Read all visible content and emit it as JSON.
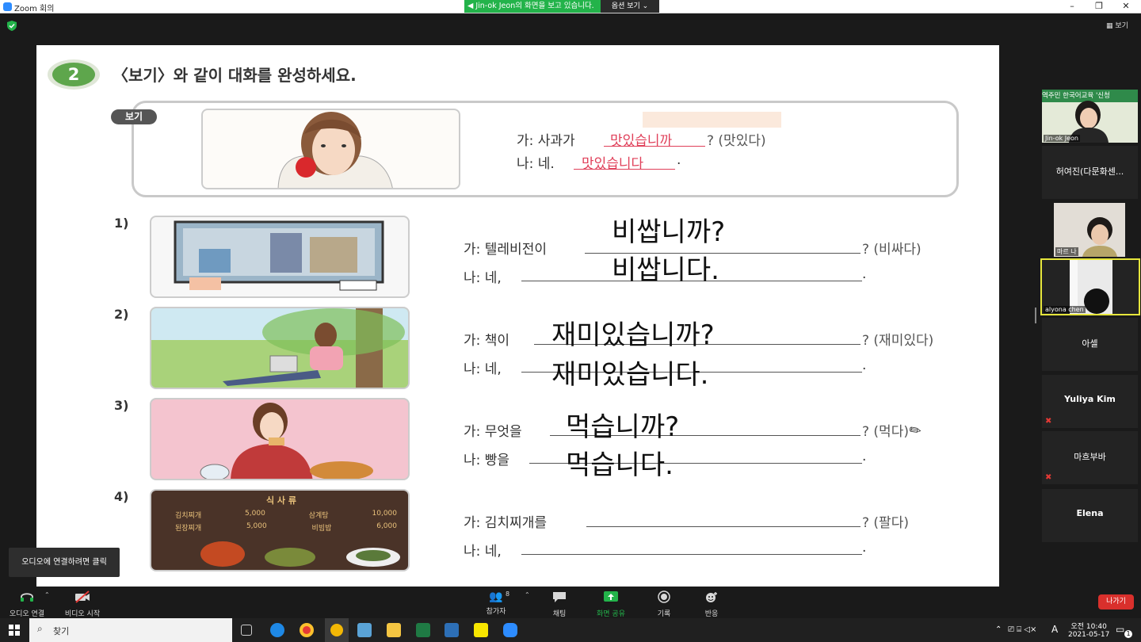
{
  "window": {
    "title": "Zoom 회의",
    "minimize": "–",
    "restore": "❐",
    "close": "✕"
  },
  "banner": {
    "sharing_text": "Jin-ok Jeon의 화면을 보고 있습니다.",
    "view_options": "옵션 보기 ⌄"
  },
  "top_right": {
    "view_label": "보기"
  },
  "slide": {
    "number": "2",
    "instruction": "〈보기〉와 같이 대화를 완성하세요.",
    "example_tag": "보기",
    "example": {
      "q_prefix": "가: 사과가",
      "q_answer": "맛있습니까",
      "q_hint": "? (맛있다)",
      "a_prefix": "나: 네.",
      "a_answer": "맛있습니다",
      "a_suffix": "."
    },
    "items": [
      {
        "num": "1)",
        "q_prefix": "가: 텔레비전이",
        "q_hint": "? (비싸다)",
        "a_prefix": "나: 네,",
        "a_suffix": ".",
        "q_written": "비쌉니까?",
        "a_written": "비쌉니다."
      },
      {
        "num": "2)",
        "q_prefix": "가: 책이",
        "q_hint": "? (재미있다)",
        "a_prefix": "나: 네,",
        "a_suffix": ".",
        "q_written": "재미있습니까?",
        "a_written": "재미있습니다."
      },
      {
        "num": "3)",
        "q_prefix": "가: 무엇을",
        "q_hint": "? (먹다)",
        "a_prefix": "나: 빵을",
        "a_suffix": ".",
        "q_written": "먹습니까?",
        "a_written": "먹습니다."
      },
      {
        "num": "4)",
        "q_prefix": "가: 김치찌개를",
        "q_hint": "? (팔다)",
        "a_prefix": "나: 네,",
        "a_suffix": ".",
        "q_written": "",
        "a_written": ""
      }
    ],
    "menu_board": {
      "title": "식 사 류",
      "rows": [
        [
          "김치찌개",
          "5,000",
          "삼계탕",
          "10,000"
        ],
        [
          "된장찌개",
          "5,000",
          "비빔밥",
          "6,000"
        ]
      ]
    }
  },
  "participants_panel": {
    "video_tiles": [
      {
        "label": "Jin-ok Jeon",
        "banner_text": "역주민 한국어교육 '신청"
      },
      {
        "label": "마르 나"
      },
      {
        "label": "alyona chen"
      }
    ],
    "name_tiles": [
      {
        "name": "허여진(다문화센...",
        "muted": false
      },
      {
        "name": "아셀",
        "muted": false
      },
      {
        "name": "Yuliya Kim",
        "muted": true
      },
      {
        "name": "마흐부바",
        "muted": true
      },
      {
        "name": "Elena",
        "muted": false
      }
    ]
  },
  "toolbar": {
    "audio_label": "오디오 연결",
    "video_label": "비디오 시작",
    "participants_label": "참가자",
    "participants_count": "8",
    "chat_label": "채팅",
    "share_label": "화면 공유",
    "record_label": "기록",
    "reactions_label": "반응",
    "leave_label": "나가기",
    "audio_tooltip": "오디오에 연결하려면 클릭"
  },
  "taskbar": {
    "search_placeholder": "찾기",
    "time": "오전 10:40",
    "date": "2021-05-17",
    "ime": "A",
    "notification_count": "1"
  },
  "colors": {
    "share_green": "#23b34a",
    "leave_red": "#d9302c",
    "answer_pink": "#e0405a",
    "active_speaker": "#e6e63c"
  }
}
